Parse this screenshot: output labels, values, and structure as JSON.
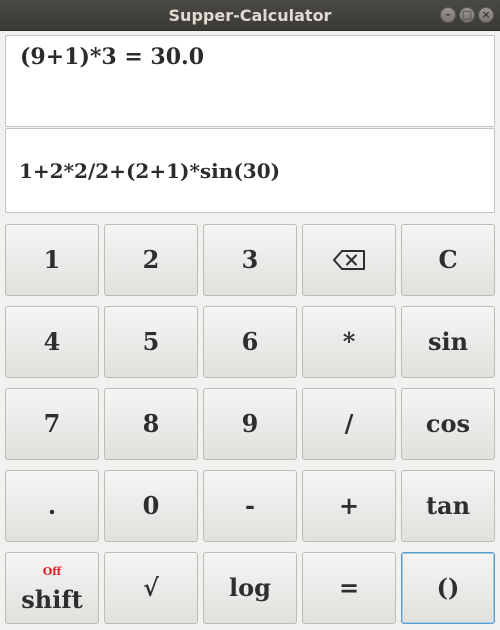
{
  "window": {
    "title": "Supper-Calculator",
    "minimize_glyph": "–",
    "maximize_glyph": "□",
    "close_glyph": "×"
  },
  "display": {
    "result": "(9+1)*3 = 30.0",
    "input": "1+2*2/2+(2+1)*sin(30)"
  },
  "keys": {
    "k1": "1",
    "k2": "2",
    "k3": "3",
    "backspace_icon": "backspace-icon",
    "clear": "C",
    "k4": "4",
    "k5": "5",
    "k6": "6",
    "multiply": "*",
    "sin": "sin",
    "k7": "7",
    "k8": "8",
    "k9": "9",
    "divide": "/",
    "cos": "cos",
    "dot": ".",
    "k0": "0",
    "minus": "-",
    "plus": "+",
    "tan": "tan",
    "shift_state": "Off",
    "shift": "shift",
    "sqrt": "√",
    "log": "log",
    "equals": "=",
    "parens": "()"
  },
  "colors": {
    "shift_state": "#e01b24",
    "focus_border": "#5a9bc9"
  }
}
